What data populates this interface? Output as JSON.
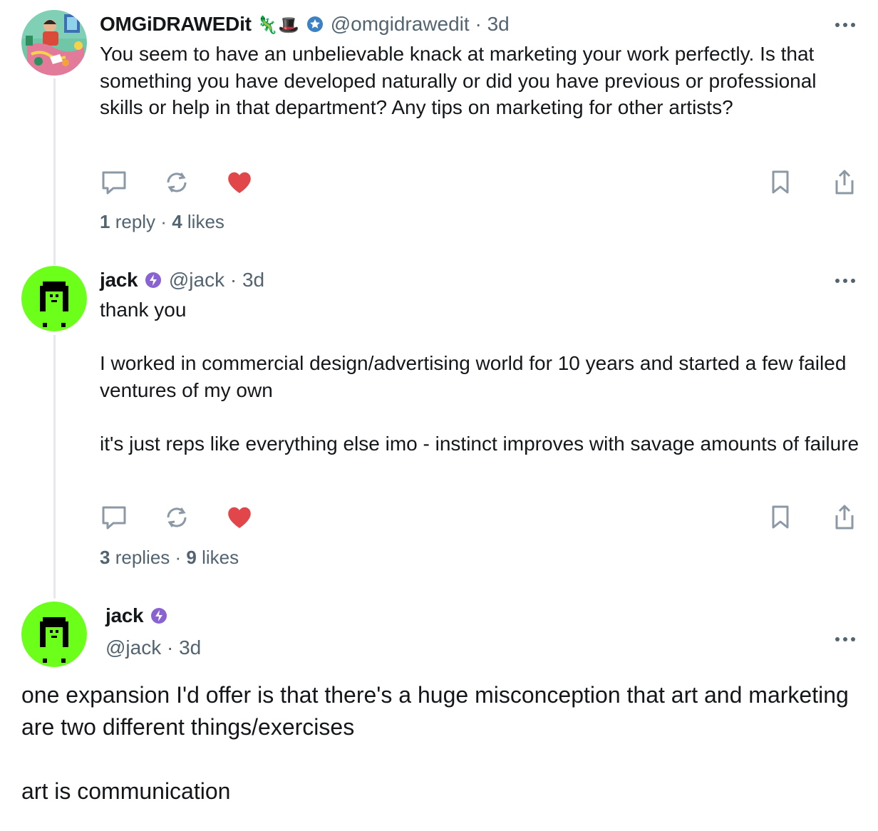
{
  "posts": [
    {
      "display_name": "OMGiDRAWEDit",
      "name_emojis": "🦎🎩",
      "handle": "@omgidrawedit",
      "separator": "·",
      "time": "3d",
      "paragraphs": [
        "You seem to have an unbelievable knack at marketing your work perfectly. Is that something you have developed naturally or did you have previous or professional skills or help in that department? Any tips on marketing for other artists?"
      ],
      "replies_count": "1",
      "replies_label": "reply",
      "likes_count": "4",
      "likes_label": "likes",
      "liked": true
    },
    {
      "display_name": "jack",
      "handle": "@jack",
      "separator": "·",
      "time": "3d",
      "paragraphs": [
        "thank you",
        "I worked in commercial design/advertising world for 10 years and started a few failed ventures of my own",
        "it's just reps like everything else imo - instinct improves with savage amounts of failure"
      ],
      "replies_count": "3",
      "replies_label": "replies",
      "likes_count": "9",
      "likes_label": "likes",
      "liked": true
    },
    {
      "display_name": "jack",
      "handle": "@jack",
      "separator": "·",
      "time": "3d",
      "paragraphs": [
        "one expansion I'd offer is that there's a huge misconception that art and marketing are two different things/exercises",
        "art is communication"
      ]
    }
  ],
  "colors": {
    "like_red": "#e0464a",
    "icon_gray": "#8b98a5",
    "verified_blue": "#3b82c4",
    "verified_purple": "#8a63d2",
    "avatar_green": "#6cff1a"
  },
  "icons": [
    "reply-icon",
    "repost-icon",
    "heart-icon",
    "bookmark-icon",
    "share-icon",
    "more-icon",
    "verified-badge-icon"
  ]
}
